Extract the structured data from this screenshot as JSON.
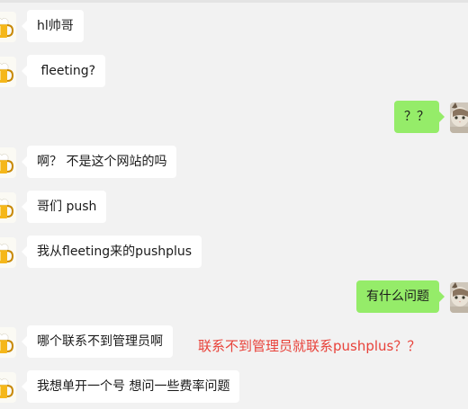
{
  "conversation": {
    "messages": [
      {
        "side": "left",
        "text": "hl帅哥",
        "avatar": "beer-mug-icon"
      },
      {
        "side": "left",
        "text": " fleeting?",
        "avatar": "beer-mug-icon"
      },
      {
        "side": "right",
        "text": "？？",
        "avatar": "cat-photo-icon"
      },
      {
        "side": "left",
        "text": "啊？ 不是这个网站的吗",
        "avatar": "beer-mug-icon"
      },
      {
        "side": "left",
        "text": "哥们 push",
        "avatar": "beer-mug-icon"
      },
      {
        "side": "left",
        "text": "我从fleeting来的pushplus",
        "avatar": "beer-mug-icon"
      },
      {
        "side": "right",
        "text": "有什么问题",
        "avatar": "cat-photo-icon"
      },
      {
        "side": "left",
        "text": "哪个联系不到管理员啊",
        "avatar": "beer-mug-icon"
      },
      {
        "side": "left",
        "text": "我想单开一个号 想问一些费率问题",
        "avatar": "beer-mug-icon"
      }
    ]
  },
  "annotation": {
    "text": "联系不到管理员就联系pushplus？？",
    "color": "#e8423a"
  },
  "colors": {
    "background": "#f2f2f2",
    "left_bubble": "#ffffff",
    "right_bubble": "#95ec69"
  }
}
